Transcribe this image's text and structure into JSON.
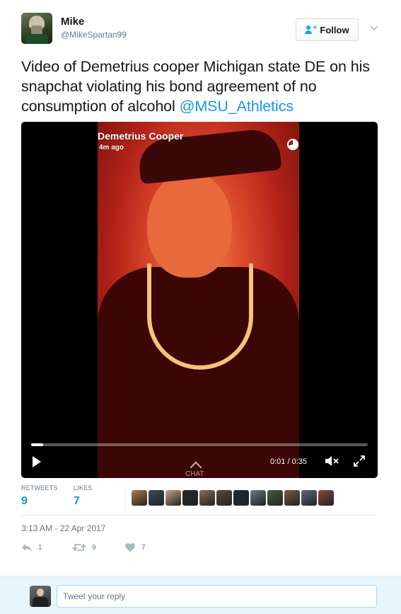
{
  "author": {
    "name": "Mike",
    "handle": "@MikeSpartan99",
    "follow_label": "Follow"
  },
  "tweet": {
    "text": "Video of Demetrius cooper Michigan state DE on his snapchat violating his bond agreement of no consumption of alcohol ",
    "mention": "@MSU_Athletics"
  },
  "video": {
    "snap_name": "Demetrius Cooper",
    "snap_time": "4m ago",
    "chat_label": "CHAT",
    "time_readout": "0:01 / 0:35",
    "progress": 0.035
  },
  "stats": {
    "retweets_label": "RETWEETS",
    "retweets_value": "9",
    "likes_label": "LIKES",
    "likes_value": "7",
    "avatar_colors": [
      "#b07a4a",
      "#3d4a5a",
      "#c9a58a",
      "#2a2a2a",
      "#8a6a5a",
      "#5a4a3a",
      "#1f2a3a",
      "#6a7a8a",
      "#4a5a3a",
      "#7a5a4a",
      "#5a6a7a",
      "#8a4a3a"
    ]
  },
  "timestamp": "3:13 AM - 22 Apr 2017",
  "actions": {
    "reply_count": "1",
    "retweet_count": "9",
    "like_count": "7"
  },
  "reply": {
    "placeholder": "Tweet your reply"
  },
  "colors": {
    "link": "#1b95e0",
    "muted": "#657786",
    "reply_bg": "#e8f5fd"
  }
}
